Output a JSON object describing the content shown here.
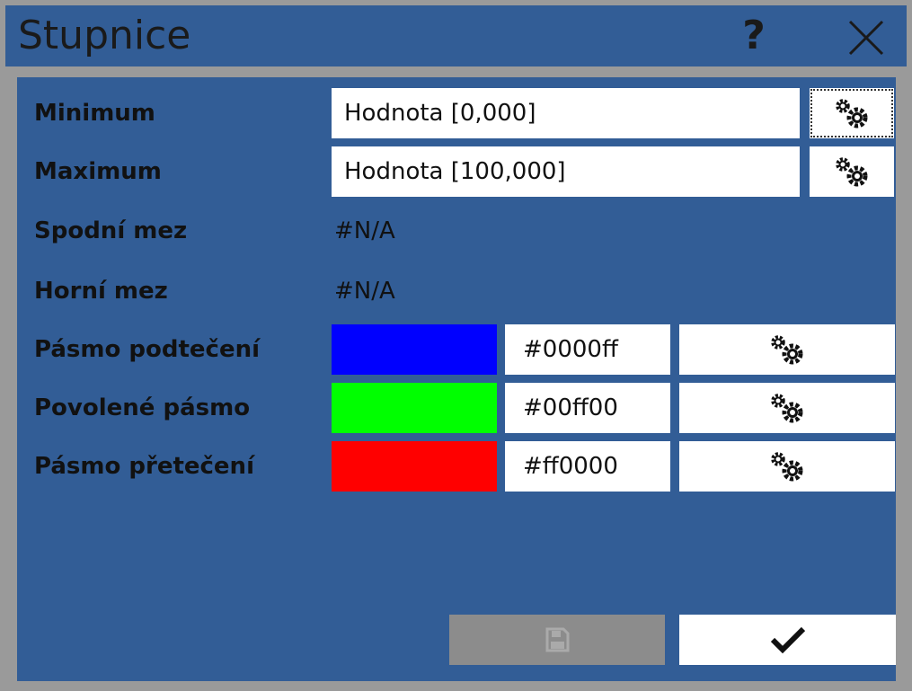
{
  "window": {
    "title": "Stupnice",
    "help_label": "?",
    "close_icon": "close-icon"
  },
  "form": {
    "minimum": {
      "label": "Minimum",
      "value": "Hodnota [0,000]"
    },
    "maximum": {
      "label": "Maximum",
      "value": "Hodnota [100,000]"
    },
    "lower_limit": {
      "label": "Spodní mez",
      "value": "#N/A"
    },
    "upper_limit": {
      "label": "Horní mez",
      "value": "#N/A"
    },
    "bands": [
      {
        "label": "Pásmo podtečení",
        "color": "#0000ff",
        "hex": "#0000ff"
      },
      {
        "label": "Povolené pásmo",
        "color": "#00ff00",
        "hex": "#00ff00"
      },
      {
        "label": "Pásmo přetečení",
        "color": "#ff0000",
        "hex": "#ff0000"
      }
    ]
  },
  "footer": {
    "save_icon": "save-icon",
    "save_enabled": false,
    "ok_icon": "checkmark-icon"
  },
  "colors": {
    "dialog_bg": "#325d96",
    "frame": "#9a9a9a",
    "disabled_button": "#8c8c8c"
  }
}
